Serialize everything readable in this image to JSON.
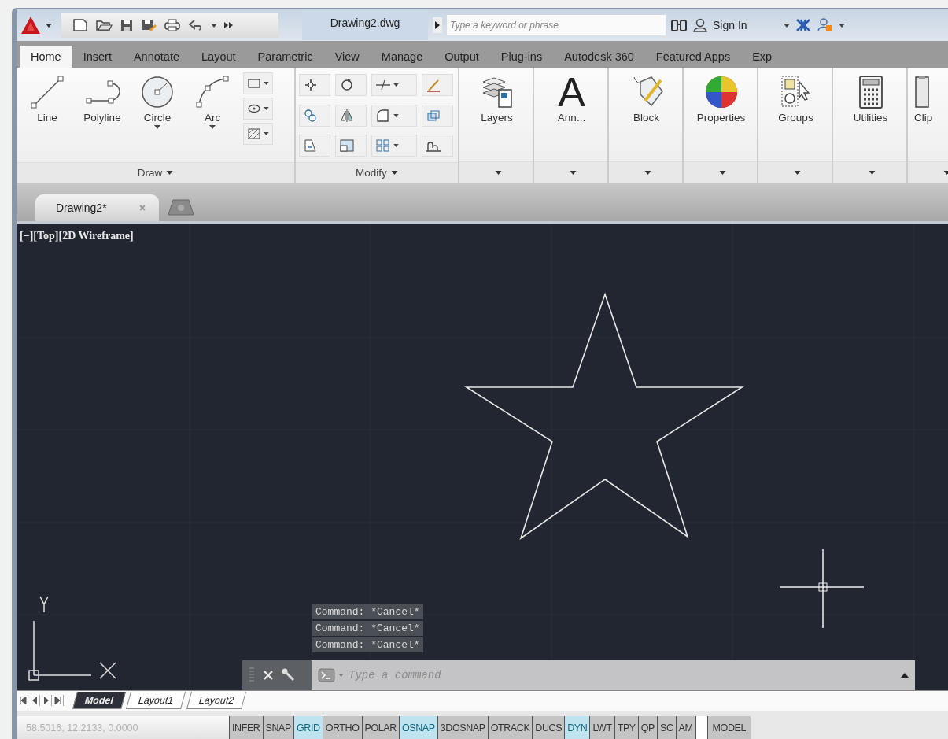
{
  "title_bar": {
    "title": "Drawing2.dwg",
    "search": {
      "placeholder": "Type a keyword or phrase"
    },
    "sign_in": "Sign In"
  },
  "ribbon_tabs": [
    {
      "label": "Home",
      "selected": true
    },
    {
      "label": "Insert",
      "selected": false
    },
    {
      "label": "Annotate",
      "selected": false
    },
    {
      "label": "Layout",
      "selected": false
    },
    {
      "label": "Parametric",
      "selected": false
    },
    {
      "label": "View",
      "selected": false
    },
    {
      "label": "Manage",
      "selected": false
    },
    {
      "label": "Output",
      "selected": false
    },
    {
      "label": "Plug-ins",
      "selected": false
    },
    {
      "label": "Autodesk 360",
      "selected": false
    },
    {
      "label": "Featured Apps",
      "selected": false
    },
    {
      "label": "Exp",
      "selected": false
    }
  ],
  "draw_panel": {
    "title": "Draw",
    "tools": [
      {
        "label": "Line",
        "dropdown": false
      },
      {
        "label": "Polyline",
        "dropdown": false
      },
      {
        "label": "Circle",
        "dropdown": true
      },
      {
        "label": "Arc",
        "dropdown": true
      }
    ]
  },
  "modify_panel": {
    "title": "Modify"
  },
  "panels": [
    {
      "label": "Layers"
    },
    {
      "label": "Ann...",
      "glyph": "A"
    },
    {
      "label": "Block"
    },
    {
      "label": "Properties"
    },
    {
      "label": "Groups"
    },
    {
      "label": "Utilities"
    },
    {
      "label": "Clip"
    }
  ],
  "document_tabs": [
    {
      "label": "Drawing2*",
      "selected": true
    }
  ],
  "viewport": {
    "label": "[−][Top][2D Wireframe]"
  },
  "command_history": [
    "Command: *Cancel*",
    "Command: *Cancel*",
    "Command: *Cancel*"
  ],
  "command_line": {
    "placeholder": "Type a command"
  },
  "layout_tabs": [
    {
      "label": "Model",
      "selected": true
    },
    {
      "label": "Layout1",
      "selected": false
    },
    {
      "label": "Layout2",
      "selected": false
    }
  ],
  "status_bar": {
    "coordinates": "58.5016, 12.2133, 0.0000",
    "disabled": true,
    "toggles": [
      {
        "label": "INFER",
        "on": false
      },
      {
        "label": "SNAP",
        "on": false
      },
      {
        "label": "GRID",
        "on": true
      },
      {
        "label": "ORTHO",
        "on": false
      },
      {
        "label": "POLAR",
        "on": false
      },
      {
        "label": "OSNAP",
        "on": true
      },
      {
        "label": "3DOSNAP",
        "on": false
      },
      {
        "label": "OTRACK",
        "on": false
      },
      {
        "label": "DUCS",
        "on": false
      },
      {
        "label": "DYN",
        "on": true
      },
      {
        "label": "LWT",
        "on": false
      },
      {
        "label": "TPY",
        "on": false
      },
      {
        "label": "QP",
        "on": false
      },
      {
        "label": "SC",
        "on": false
      },
      {
        "label": "AM",
        "on": false
      }
    ],
    "mode": "MODEL"
  }
}
